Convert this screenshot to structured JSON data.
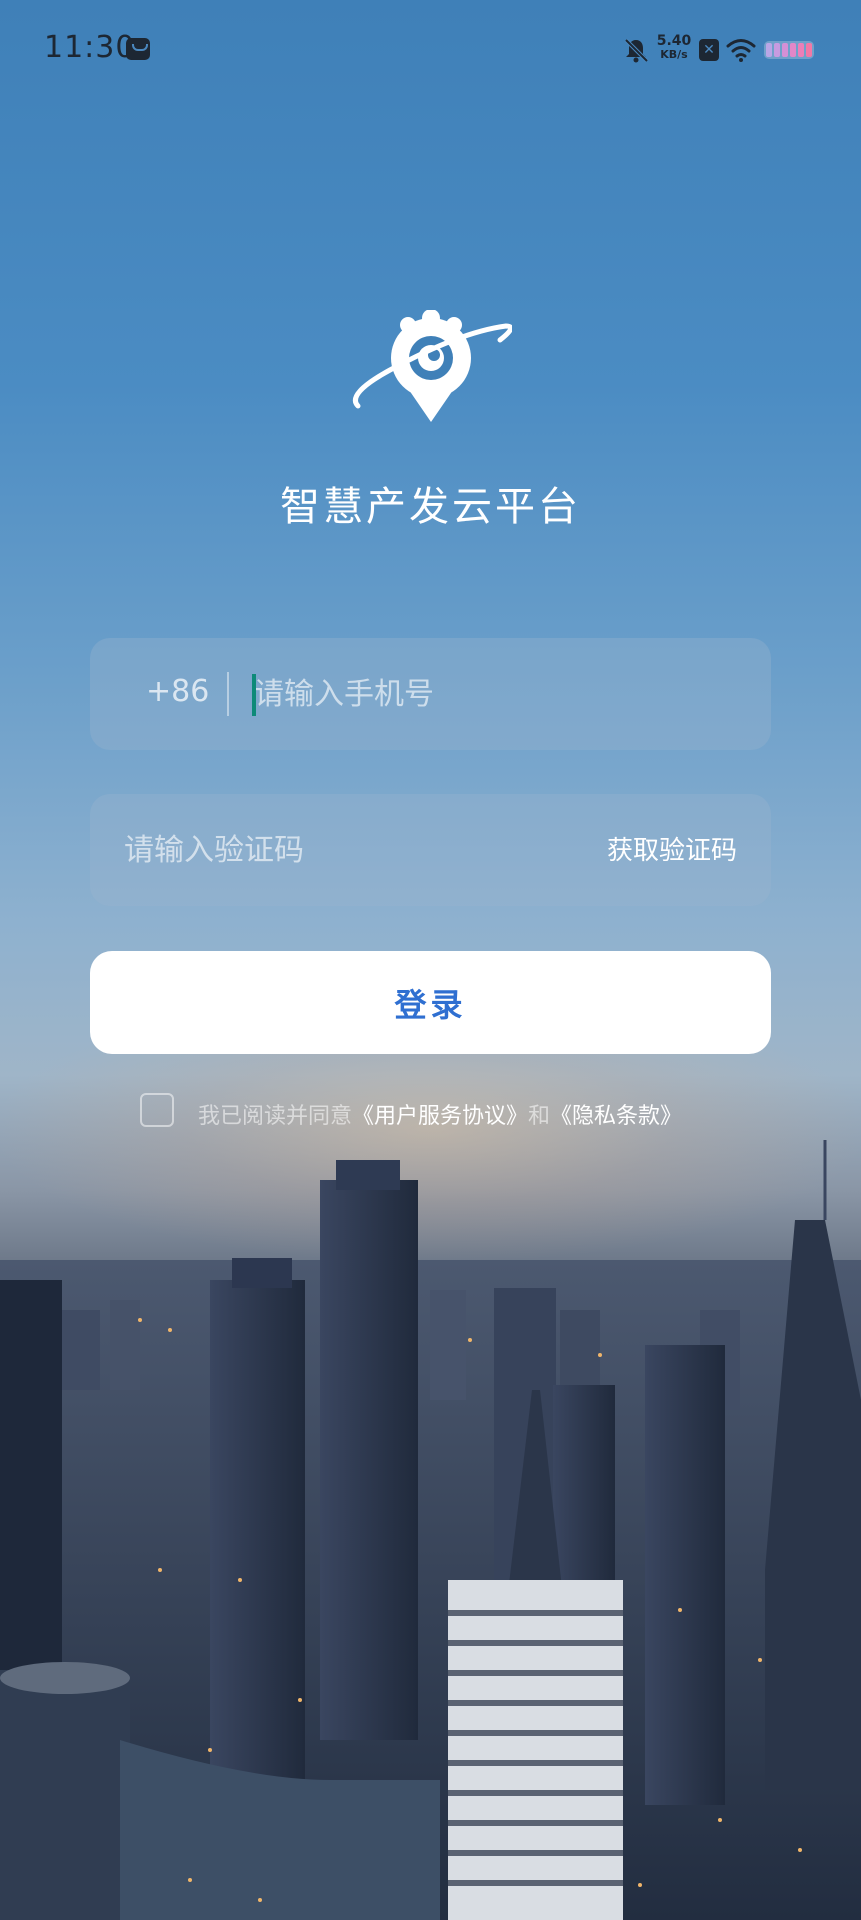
{
  "status_bar": {
    "time": "11:30",
    "net_speed_value": "5.40",
    "net_speed_unit": "KB/s",
    "sim_label": "✕",
    "icons": [
      "message-icon",
      "bell-off-icon",
      "sim-x-icon",
      "wifi-icon",
      "battery-icon"
    ]
  },
  "app": {
    "title": "智慧产发云平台",
    "logo_icon": "planet-pin-logo"
  },
  "phone_field": {
    "country_code": "+86",
    "placeholder": "请输入手机号",
    "value": ""
  },
  "code_field": {
    "placeholder": "请输入验证码",
    "value": "",
    "get_code_label": "获取验证码"
  },
  "login": {
    "label": "登录"
  },
  "agreement": {
    "prefix": "我已阅读并同意",
    "user_agreement": "《用户服务协议》",
    "conjunction": "和",
    "privacy": "《隐私条款》",
    "checked": false
  },
  "colors": {
    "accent": "#2f6fd1",
    "cursor": "#0e8a78",
    "field_bg": "rgba(155,180,205,0.35)"
  }
}
